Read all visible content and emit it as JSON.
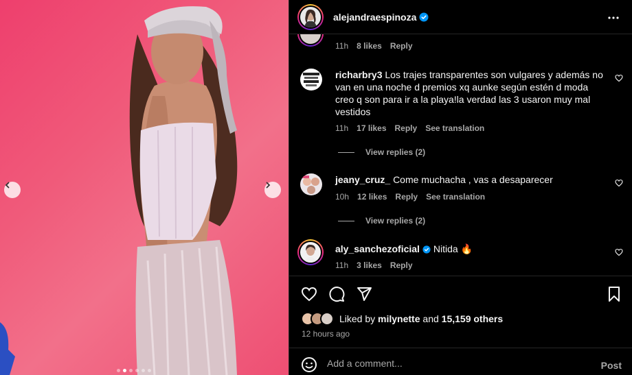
{
  "post": {
    "author": "alejandraespinoza",
    "dots_total": 6,
    "dots_active": 1
  },
  "comments": [
    {
      "username": "",
      "text": "",
      "time": "11h",
      "likes": "8 likes",
      "reply": "Reply"
    },
    {
      "username": "richarbry3",
      "text": "Los trajes transparentes son vulgares y además no van en una noche d premios xq aunke según estén d moda creo q son para ir a la playa!la verdad las 3 usaron muy mal vestidos",
      "time": "11h",
      "likes": "17 likes",
      "reply": "Reply",
      "translate": "See translation",
      "view_replies": "View replies (2)"
    },
    {
      "username": "jeany_cruz_",
      "text": "Come muchacha , vas a desaparecer",
      "time": "10h",
      "likes": "12 likes",
      "reply": "Reply",
      "translate": "See translation",
      "view_replies": "View replies (2)"
    },
    {
      "username": "aly_sanchezoficial",
      "text": "Nitida",
      "emoji": "🔥",
      "time": "11h",
      "likes": "3 likes",
      "reply": "Reply"
    }
  ],
  "likes": {
    "prefix": "Liked by ",
    "user": "milynette",
    "middle": " and ",
    "count": "15,159 others"
  },
  "time_ago": "12 hours ago",
  "comment_box": {
    "placeholder": "Add a comment...",
    "post_label": "Post"
  },
  "icons": {
    "like": "heart-icon",
    "comment": "comment-icon",
    "share": "send-icon",
    "save": "bookmark-icon",
    "more": "more-icon",
    "emoji": "emoji-icon",
    "verified": "verified-badge-icon"
  },
  "colors": {
    "background": "#000000",
    "text": "#f5f5f5",
    "secondary_text": "#a8a8a8",
    "verified": "#0095f6",
    "photo_bg": "#ee3f6d"
  }
}
